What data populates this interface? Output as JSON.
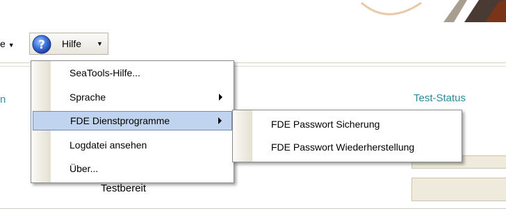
{
  "menubar": {
    "prev_label": "e",
    "help_label": "Hilfe"
  },
  "panel": {
    "left_label": "n",
    "right_label": "Test-Status",
    "status_text": "Testbereit"
  },
  "help_menu": {
    "items": [
      {
        "label": "SeaTools-Hilfe...",
        "has_submenu": false
      },
      {
        "label": "Sprache",
        "has_submenu": true
      },
      {
        "label": "FDE Dienstprogramme",
        "has_submenu": true,
        "highlighted": true
      },
      {
        "label": "Logdatei ansehen",
        "has_submenu": false
      },
      {
        "label": "Über...",
        "has_submenu": false
      }
    ]
  },
  "fde_submenu": {
    "items": [
      {
        "label": "FDE Passwort Sicherung"
      },
      {
        "label": "FDE Passwort Wiederherstellung"
      }
    ]
  },
  "colors": {
    "highlight": "#c0d4f0",
    "highlight_border": "#6a8cc8",
    "label_teal": "#2a8a9a",
    "status_box": "#eeebdc"
  },
  "icons": {
    "help": "question-mark-icon",
    "submenu": "submenu-arrow-icon",
    "dropdown": "caret-down-icon"
  }
}
